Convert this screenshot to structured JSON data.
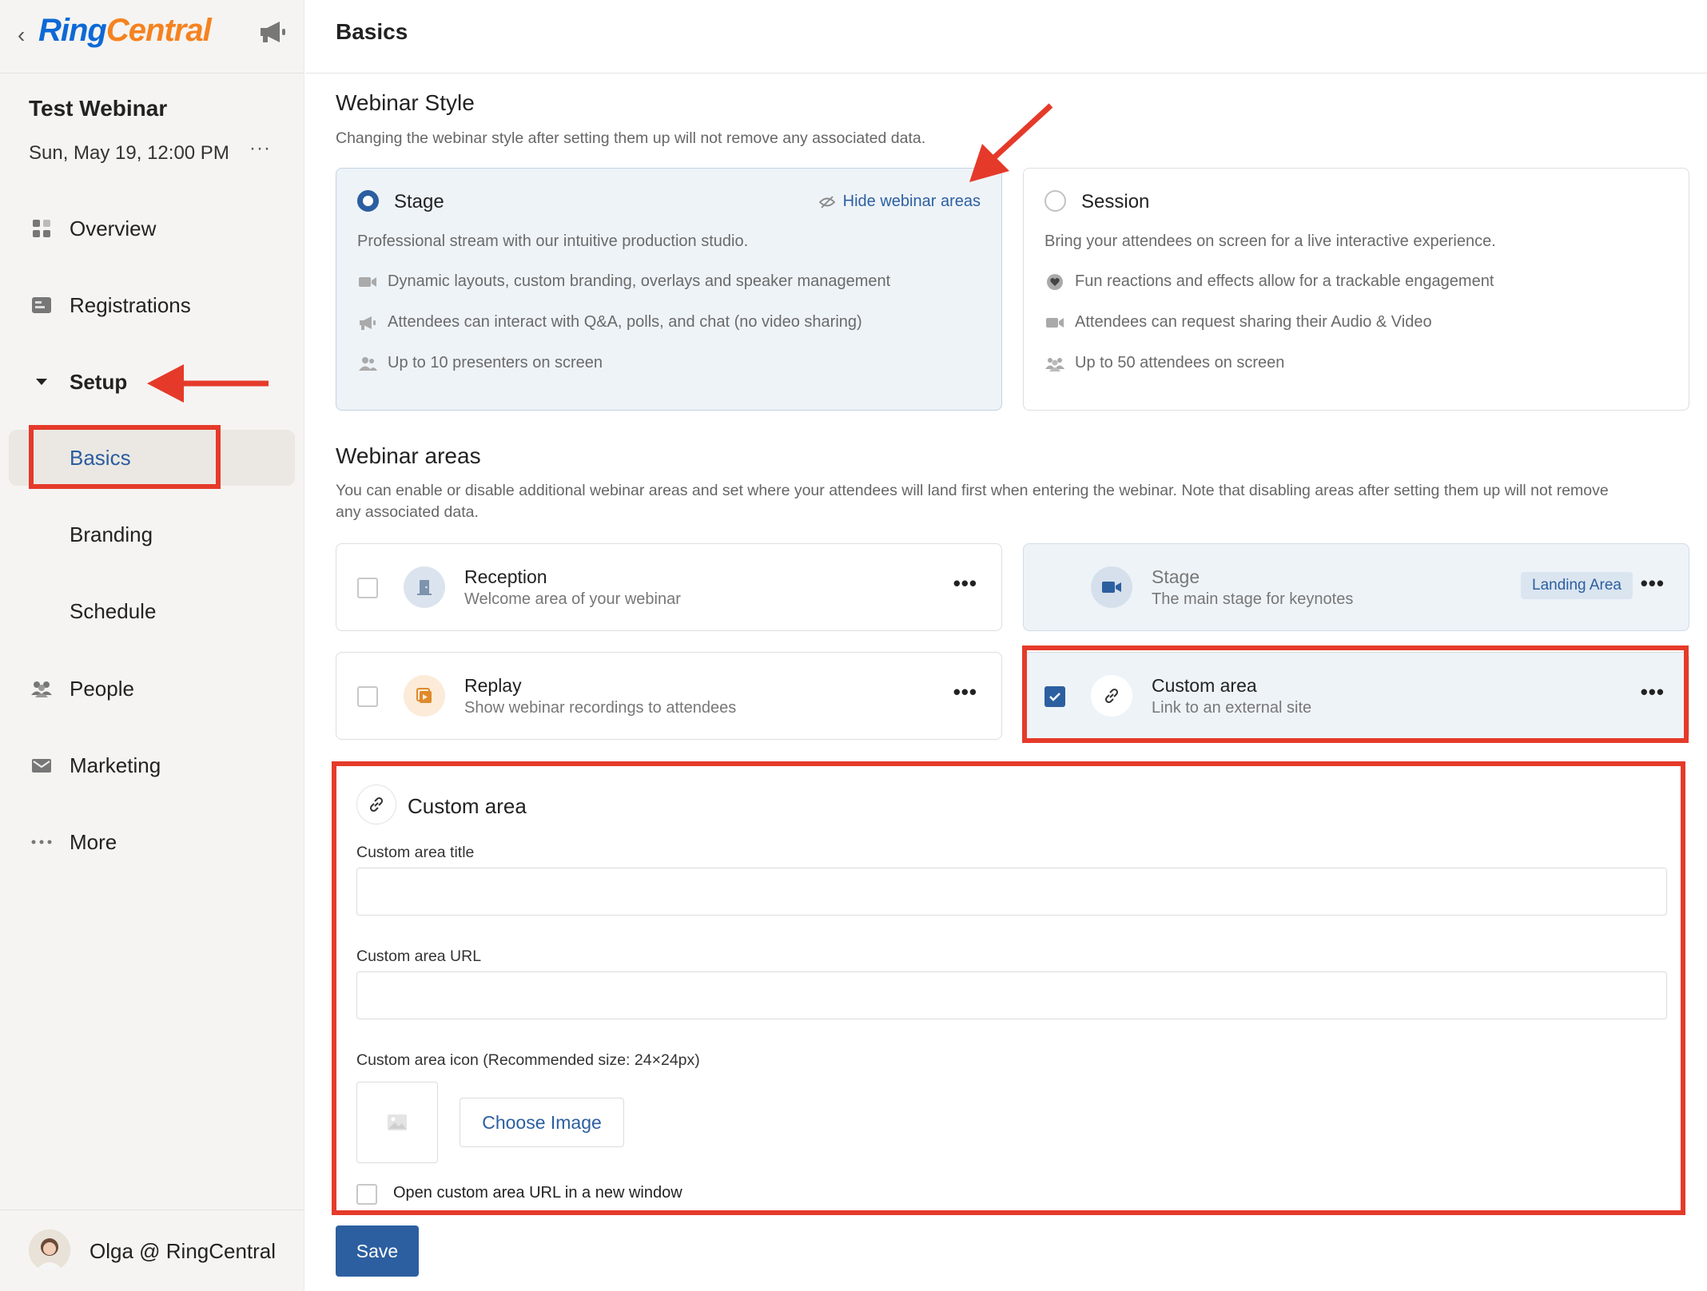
{
  "sidebar": {
    "logo_ring": "Ring",
    "logo_central": "Central",
    "event_title": "Test Webinar",
    "event_date": "Sun, May 19, 12:00 PM",
    "event_more": "···",
    "nav": {
      "overview": "Overview",
      "registrations": "Registrations",
      "setup": "Setup",
      "people": "People",
      "marketing": "Marketing",
      "more": "More"
    },
    "setup_items": {
      "basics": "Basics",
      "branding": "Branding",
      "schedule": "Schedule"
    },
    "user_name": "Olga @ RingCentral"
  },
  "header": {
    "title": "Basics"
  },
  "webinar_style": {
    "title": "Webinar Style",
    "description": "Changing the webinar style after setting them up will not remove any associated data.",
    "stage": {
      "title": "Stage",
      "selected": true,
      "hide_link": "Hide webinar areas",
      "description": "Professional stream with our intuitive production studio.",
      "features": [
        "Dynamic layouts, custom branding, overlays and speaker management",
        "Attendees can interact with Q&A, polls, and chat (no video sharing)",
        "Up to 10 presenters on screen"
      ]
    },
    "session": {
      "title": "Session",
      "selected": false,
      "description": "Bring your attendees on screen for a live interactive experience.",
      "features": [
        "Fun reactions and effects allow for a trackable engagement",
        "Attendees can request sharing their Audio & Video",
        "Up to 50 attendees on screen"
      ]
    }
  },
  "webinar_areas": {
    "title": "Webinar areas",
    "description_line1": "You can enable or disable additional webinar areas and set where your attendees will land first when entering the webinar. Note that disabling areas after setting them up will not remove",
    "description_line2": "any associated data.",
    "items": [
      {
        "title": "Reception",
        "subtitle": "Welcome area of your webinar",
        "checked": false
      },
      {
        "title": "Stage",
        "subtitle": "The main stage for keynotes",
        "badge": "Landing Area"
      },
      {
        "title": "Replay",
        "subtitle": "Show webinar recordings to attendees",
        "checked": false
      },
      {
        "title": "Custom area",
        "subtitle": "Link to an external site",
        "checked": true
      }
    ],
    "more_label": "•••"
  },
  "custom_area": {
    "title": "Custom area",
    "title_label": "Custom area title",
    "title_value": "",
    "url_label": "Custom area URL",
    "url_value": "",
    "icon_label": "Custom area icon (Recommended size: 24×24px)",
    "choose_image": "Choose Image",
    "new_window_label": "Open custom area URL in a new window",
    "new_window_checked": false
  },
  "save_label": "Save",
  "colors": {
    "accent": "#2c5fa0",
    "annotation_red": "#e53a2a",
    "logo_blue": "#0d69d6",
    "logo_orange": "#f58220"
  }
}
